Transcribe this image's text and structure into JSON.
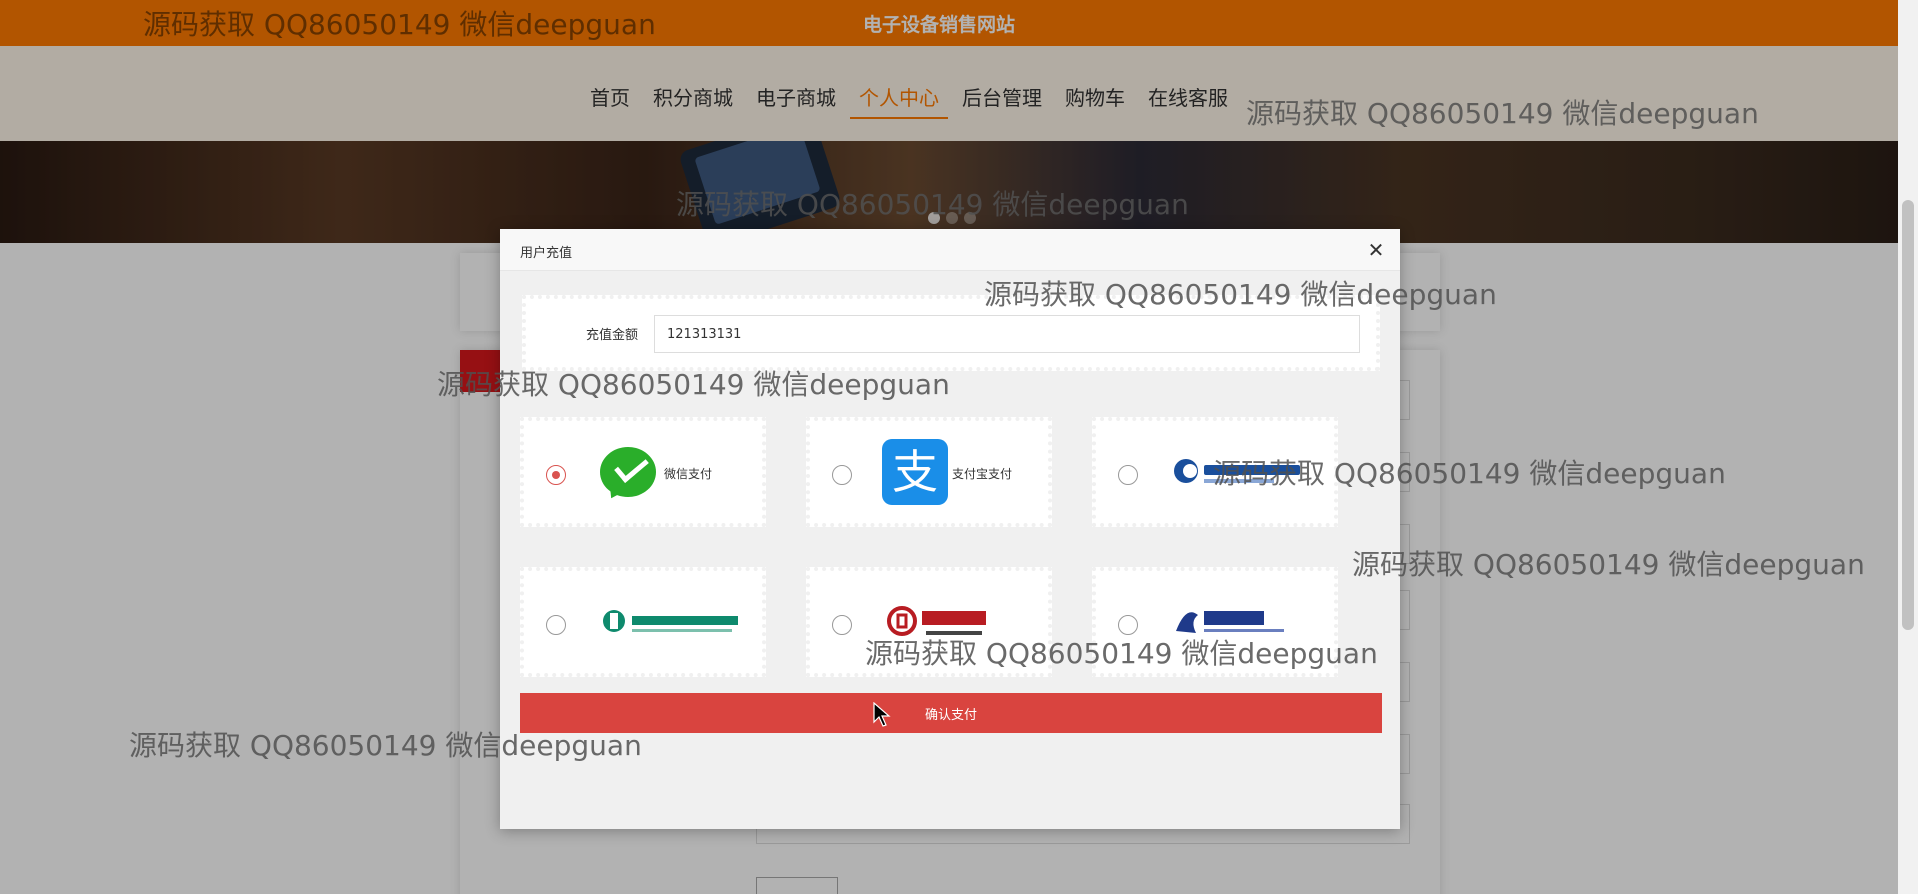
{
  "site": {
    "title": "电子设备销售网站"
  },
  "nav": {
    "items": [
      {
        "label": "首页",
        "active": false
      },
      {
        "label": "积分商城",
        "active": false
      },
      {
        "label": "电子商城",
        "active": false
      },
      {
        "label": "个人中心",
        "active": true
      },
      {
        "label": "后台管理",
        "active": false
      },
      {
        "label": "购物车",
        "active": false
      },
      {
        "label": "在线客服",
        "active": false
      }
    ]
  },
  "banner": {
    "slide_count": 3,
    "active_slide": 1
  },
  "colors": {
    "brand_orange": "#ff7a00",
    "confirm_red": "#d9443f",
    "wechat_green": "#2aae2a",
    "alipay_blue": "#1a8ee8"
  },
  "modal": {
    "title": "用户充值",
    "close_icon": "close-icon",
    "amount_label": "充值金额",
    "amount_value": "121313131",
    "payment_options": [
      {
        "id": "wechat",
        "label": "微信支付",
        "icon": "wechat-pay-icon",
        "selected": true
      },
      {
        "id": "alipay",
        "label": "支付宝支付",
        "icon": "alipay-icon",
        "selected": false
      },
      {
        "id": "ccb",
        "label": "",
        "icon": "china-construction-bank-logo",
        "selected": false
      },
      {
        "id": "abc",
        "label": "",
        "icon": "agricultural-bank-of-china-logo",
        "selected": false
      },
      {
        "id": "boc",
        "label": "",
        "icon": "bank-of-china-logo",
        "selected": false
      },
      {
        "id": "bocom",
        "label": "",
        "icon": "bank-of-communications-logo",
        "selected": false
      }
    ],
    "confirm_label": "确认支付"
  },
  "watermark": {
    "text": "源码获取 QQ86050149 微信deepguan"
  }
}
